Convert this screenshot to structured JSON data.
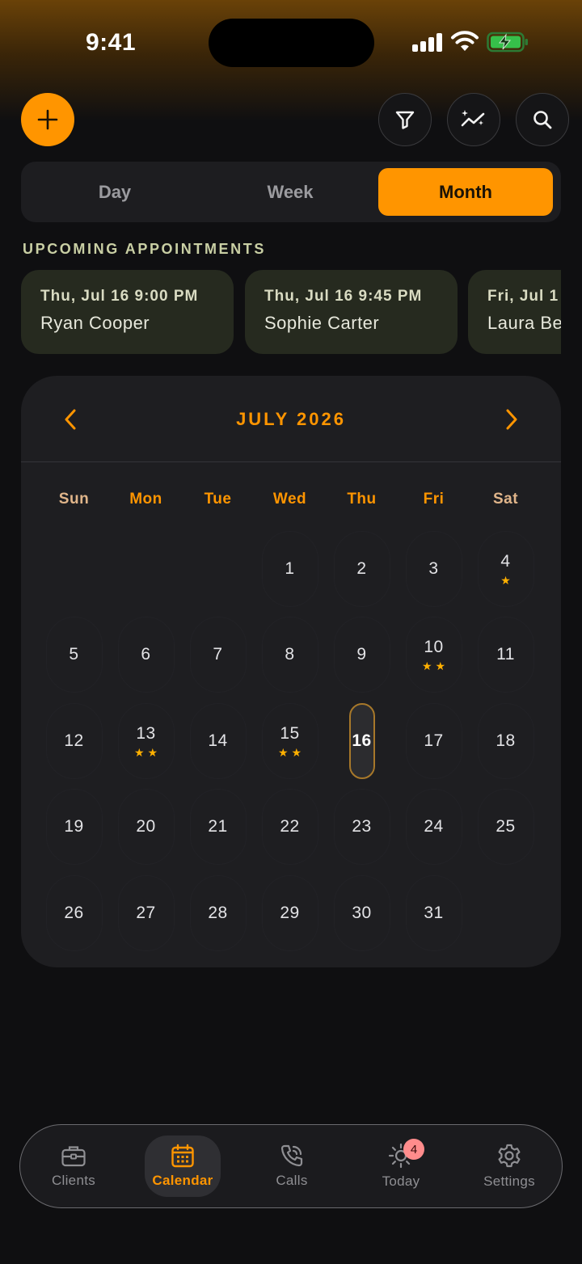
{
  "status_bar": {
    "time": "9:41"
  },
  "toolbar": {
    "add_icon": "plus-icon",
    "filter_icon": "filter-icon",
    "insights_icon": "sparkle-chart-icon",
    "search_icon": "search-icon"
  },
  "view_switcher": {
    "options": [
      "Day",
      "Week",
      "Month"
    ],
    "selected": "Month"
  },
  "upcoming": {
    "title": "UPCOMING APPOINTMENTS",
    "items": [
      {
        "date": "Thu, Jul 16 9:00 PM",
        "name": "Ryan Cooper"
      },
      {
        "date": "Thu, Jul 16 9:45 PM",
        "name": "Sophie Carter"
      },
      {
        "date": "Fri, Jul 1",
        "name": "Laura Be"
      }
    ]
  },
  "calendar": {
    "title": "JULY 2026",
    "prev_icon": "chevron-left-icon",
    "next_icon": "chevron-right-icon",
    "weekdays": [
      "Sun",
      "Mon",
      "Tue",
      "Wed",
      "Thu",
      "Fri",
      "Sat"
    ],
    "weekday_colors": [
      "#e0b58a",
      "#ff9500",
      "#ff9500",
      "#ff9500",
      "#ff9500",
      "#ff9500",
      "#e0b58a"
    ],
    "weeks": [
      [
        null,
        null,
        null,
        {
          "d": "1",
          "stars": 0
        },
        {
          "d": "2",
          "stars": 0
        },
        {
          "d": "3",
          "stars": 0
        },
        {
          "d": "4",
          "stars": 1
        }
      ],
      [
        {
          "d": "5",
          "stars": 0
        },
        {
          "d": "6",
          "stars": 0
        },
        {
          "d": "7",
          "stars": 0
        },
        {
          "d": "8",
          "stars": 0
        },
        {
          "d": "9",
          "stars": 0
        },
        {
          "d": "10",
          "stars": 2
        },
        {
          "d": "11",
          "stars": 0
        }
      ],
      [
        {
          "d": "12",
          "stars": 0
        },
        {
          "d": "13",
          "stars": 2
        },
        {
          "d": "14",
          "stars": 0
        },
        {
          "d": "15",
          "stars": 2
        },
        {
          "d": "16",
          "stars": 0,
          "today": true
        },
        {
          "d": "17",
          "stars": 0
        },
        {
          "d": "18",
          "stars": 0
        }
      ],
      [
        {
          "d": "19",
          "stars": 0
        },
        {
          "d": "20",
          "stars": 0
        },
        {
          "d": "21",
          "stars": 0
        },
        {
          "d": "22",
          "stars": 0
        },
        {
          "d": "23",
          "stars": 0
        },
        {
          "d": "24",
          "stars": 0
        },
        {
          "d": "25",
          "stars": 0
        }
      ],
      [
        {
          "d": "26",
          "stars": 0
        },
        {
          "d": "27",
          "stars": 0
        },
        {
          "d": "28",
          "stars": 0
        },
        {
          "d": "29",
          "stars": 0
        },
        {
          "d": "30",
          "stars": 0
        },
        {
          "d": "31",
          "stars": 0
        },
        null
      ]
    ]
  },
  "tabbar": {
    "tabs": [
      {
        "label": "Clients",
        "icon": "briefcase-icon"
      },
      {
        "label": "Calendar",
        "icon": "calendar-icon",
        "active": true
      },
      {
        "label": "Calls",
        "icon": "phone-icon"
      },
      {
        "label": "Today",
        "icon": "sun-icon",
        "badge": "4"
      },
      {
        "label": "Settings",
        "icon": "gear-icon"
      }
    ]
  },
  "colors": {
    "accent": "#ff9500",
    "background": "#0f0f11",
    "card": "#1e1e21"
  }
}
